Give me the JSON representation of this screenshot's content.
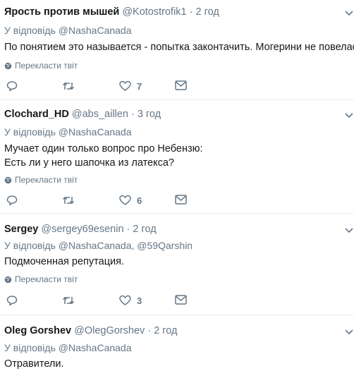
{
  "translate_label": "Перекласти твіт",
  "reply_prefix": "У відповідь",
  "tweets": [
    {
      "name": "Ярость против мышей",
      "handle": "@Kotostrofik1",
      "sep": "·",
      "time": "2 год",
      "reply_to": "@NashaCanada",
      "text": [
        "По понятием это называется - попытка законтачить. Могерини не повелась."
      ],
      "likes": "7"
    },
    {
      "name": "Clochard_HD",
      "handle": "@abs_aillen",
      "sep": "·",
      "time": "3 год",
      "reply_to": "@NashaCanada",
      "text": [
        "Мучает один только вопрос про Небензю:",
        "Есть ли у него шапочка из латекса?"
      ],
      "likes": "6"
    },
    {
      "name": "Sergey",
      "handle": "@sergey69esenin",
      "sep": "·",
      "time": "2 год",
      "reply_to": "@NashaCanada, @59Qarshin",
      "text": [
        "Подмоченная репутация."
      ],
      "likes": "3"
    },
    {
      "name": "Oleg Gorshev",
      "handle": "@OlegGorshev",
      "sep": "·",
      "time": "2 год",
      "reply_to": "@NashaCanada",
      "text": [
        "Отравители."
      ],
      "likes": ""
    }
  ]
}
